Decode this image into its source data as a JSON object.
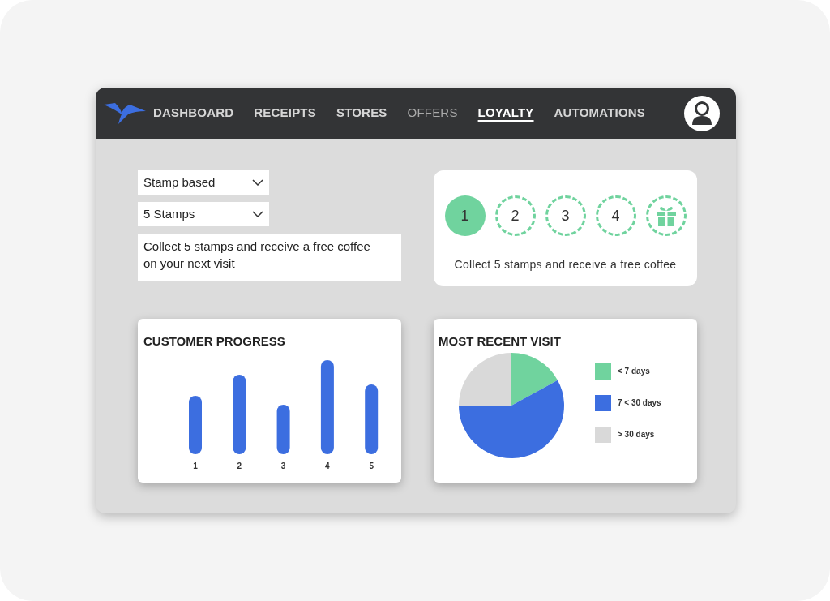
{
  "nav": {
    "items": [
      {
        "label": "DASHBOARD",
        "selected": false,
        "muted": false
      },
      {
        "label": "RECEIPTS",
        "selected": false,
        "muted": false
      },
      {
        "label": "STORES",
        "selected": false,
        "muted": false
      },
      {
        "label": "OFFERS",
        "selected": false,
        "muted": true
      },
      {
        "label": "LOYALTY",
        "selected": true,
        "muted": false
      },
      {
        "label": "AUTOMATIONS",
        "selected": false,
        "muted": false
      }
    ]
  },
  "settings": {
    "program_type": "Stamp based",
    "stamp_count": "5 Stamps",
    "description": "Collect 5 stamps and receive a free coffee on your next visit"
  },
  "stamp_card": {
    "stamps": [
      {
        "kind": "number",
        "label": "1",
        "filled": true
      },
      {
        "kind": "number",
        "label": "2",
        "filled": false
      },
      {
        "kind": "number",
        "label": "3",
        "filled": false
      },
      {
        "kind": "number",
        "label": "4",
        "filled": false
      },
      {
        "kind": "gift",
        "filled": false
      }
    ],
    "caption": "Collect 5 stamps and receive a free coffee"
  },
  "customer_progress": {
    "title": "CUSTOMER PROGRESS",
    "categories": [
      "1",
      "2",
      "3",
      "4",
      "5"
    ]
  },
  "most_recent_visit": {
    "title": "MOST RECENT VISIT",
    "legend": [
      {
        "label": "< 7 days",
        "color": "#70d39e"
      },
      {
        "label": "7 < 30 days",
        "color": "#3c6ee0"
      },
      {
        "label": "> 30 days",
        "color": "#d9d9d9"
      }
    ]
  }
}
